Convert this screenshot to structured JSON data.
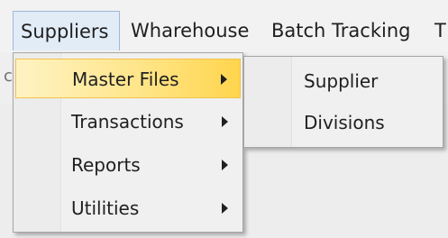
{
  "menubar": {
    "items": [
      {
        "label": "Suppliers"
      },
      {
        "label": "Wharehouse"
      },
      {
        "label": "Batch Tracking"
      },
      {
        "label": "T"
      }
    ]
  },
  "strip": {
    "left_fragment": "c",
    "right_fragment": "i"
  },
  "suppliers_menu": {
    "items": [
      {
        "label": "Master Files",
        "icon": "chevron-right-icon"
      },
      {
        "label": "Transactions",
        "icon": "chevron-right-icon"
      },
      {
        "label": "Reports",
        "icon": "chevron-right-icon"
      },
      {
        "label": "Utilities",
        "icon": "chevron-right-icon"
      }
    ]
  },
  "master_files_submenu": {
    "items": [
      {
        "label": "Supplier"
      },
      {
        "label": "Divisions"
      }
    ]
  },
  "colors": {
    "highlight": "#ffe58a",
    "menu_background": "#f0f0f0",
    "open_menubar_item": "#e2ecf7"
  }
}
